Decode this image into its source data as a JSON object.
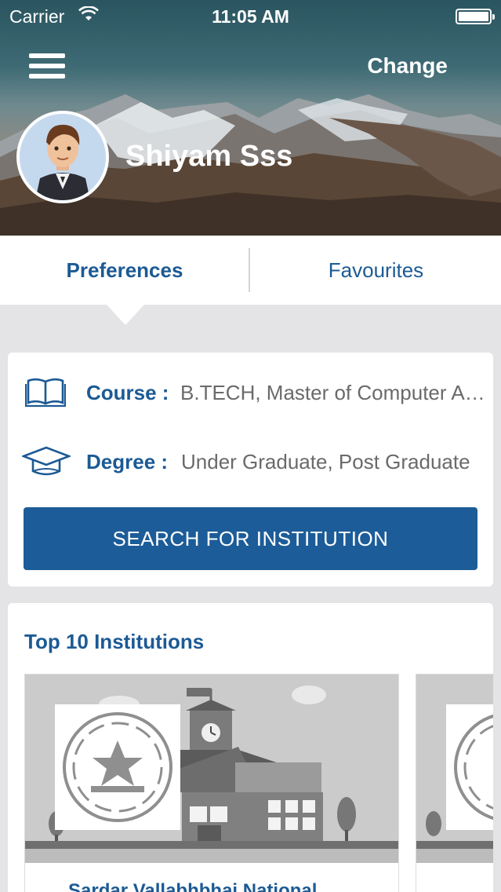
{
  "status_bar": {
    "carrier": "Carrier",
    "time": "11:05 AM"
  },
  "header": {
    "change_label": "Change",
    "user_name": "Shiyam Sss"
  },
  "tabs": [
    {
      "label": "Preferences",
      "active": true
    },
    {
      "label": "Favourites",
      "active": false
    }
  ],
  "preferences": {
    "course_label": "Course :",
    "course_value": "B.TECH, Master of Computer Applications",
    "degree_label": "Degree :",
    "degree_value": "Under Graduate, Post Graduate",
    "search_button": "SEARCH FOR INSTITUTION"
  },
  "top_institutions": {
    "title": "Top 10 Institutions",
    "items": [
      {
        "name": "Sardar Vallabhbhai National"
      },
      {
        "name": ""
      }
    ]
  },
  "colors": {
    "accent": "#1c5a94",
    "button": "#1c5c98",
    "background": "#e4e4e6"
  }
}
